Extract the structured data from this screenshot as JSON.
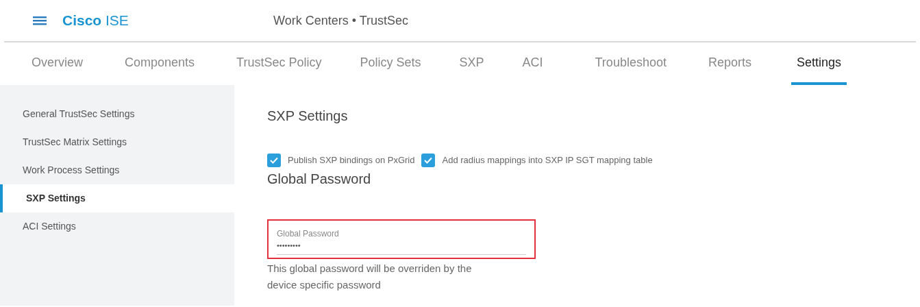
{
  "header": {
    "brand_bold": "Cisco",
    "brand_light": "ISE",
    "title": "Work Centers • TrustSec"
  },
  "tabs": [
    {
      "label": "Overview",
      "selected": false
    },
    {
      "label": "Components",
      "selected": false
    },
    {
      "label": "TrustSec Policy",
      "selected": false
    },
    {
      "label": "Policy Sets",
      "selected": false
    },
    {
      "label": "SXP",
      "selected": false
    },
    {
      "label": "ACI",
      "selected": false
    },
    {
      "label": "Troubleshoot",
      "selected": false
    },
    {
      "label": "Reports",
      "selected": false
    },
    {
      "label": "Settings",
      "selected": true
    }
  ],
  "sidebar": {
    "items": [
      {
        "label": "General TrustSec Settings",
        "selected": false
      },
      {
        "label": "TrustSec Matrix Settings",
        "selected": false
      },
      {
        "label": "Work Process Settings",
        "selected": false
      },
      {
        "label": "SXP Settings",
        "selected": true
      },
      {
        "label": "ACI Settings",
        "selected": false
      }
    ]
  },
  "content": {
    "heading": "SXP Settings",
    "checkboxes": [
      {
        "label": "Publish SXP bindings on PxGrid",
        "checked": true
      },
      {
        "label": "Add radius mappings into SXP IP SGT mapping table",
        "checked": true
      }
    ],
    "section_title": "Global Password",
    "password_field": {
      "label": "Global Password",
      "value": "•••••••••",
      "highlighted": true
    },
    "help_text": "This global password will be overriden by the device specific password"
  }
}
